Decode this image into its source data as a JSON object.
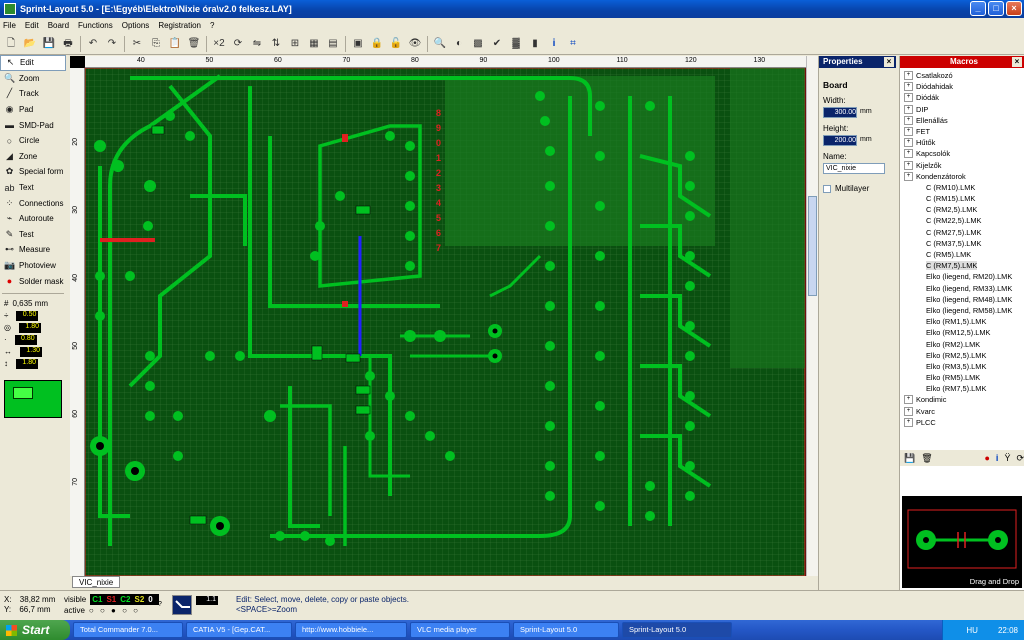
{
  "window": {
    "title": "Sprint-Layout 5.0 - [E:\\Egyéb\\Elektro\\Nixie óra\\v2.0 felkesz.LAY]"
  },
  "menu": [
    "File",
    "Edit",
    "Board",
    "Functions",
    "Options",
    "Registration",
    "?"
  ],
  "tools": [
    {
      "label": "Edit",
      "icon": "arrow-icon",
      "active": true
    },
    {
      "label": "Zoom",
      "icon": "magnifier-icon"
    },
    {
      "label": "Track",
      "icon": "track-icon"
    },
    {
      "label": "Pad",
      "icon": "pad-icon"
    },
    {
      "label": "SMD-Pad",
      "icon": "smd-pad-icon"
    },
    {
      "label": "Circle",
      "icon": "circle-icon"
    },
    {
      "label": "Zone",
      "icon": "zone-icon"
    },
    {
      "label": "Special form",
      "icon": "special-form-icon"
    },
    {
      "label": "Text",
      "icon": "text-icon"
    },
    {
      "label": "Connections",
      "icon": "connections-icon"
    },
    {
      "label": "Autoroute",
      "icon": "autoroute-icon"
    },
    {
      "label": "Test",
      "icon": "test-icon"
    },
    {
      "label": "Measure",
      "icon": "measure-icon"
    },
    {
      "label": "Photoview",
      "icon": "camera-icon"
    },
    {
      "label": "Solder mask",
      "icon": "solder-mask-icon"
    }
  ],
  "settings": {
    "grid": "0,635 mm",
    "track_width": "0.50",
    "pad_outer": "1.80",
    "pad_inner": "0.80",
    "smd_w": "1.30",
    "smd_h": "1.80"
  },
  "ruler": {
    "h": [
      "40",
      "50",
      "60",
      "70",
      "80",
      "90",
      "100",
      "110",
      "120",
      "130"
    ],
    "v": [
      "20",
      "30",
      "40",
      "50",
      "60",
      "70"
    ]
  },
  "canvas": {
    "board_tab": "VIC_nixie",
    "digits": [
      "8",
      "9",
      "0",
      "1",
      "2",
      "3",
      "4",
      "5",
      "6",
      "7"
    ]
  },
  "properties": {
    "title": "Properties",
    "section": "Board",
    "width_label": "Width:",
    "width_value": "300.00",
    "height_label": "Height:",
    "height_value": "200.00",
    "unit": "mm",
    "name_label": "Name:",
    "name_value": "VIC_nixie",
    "multilayer_label": "Multilayer"
  },
  "macros": {
    "title": "Macros",
    "items": [
      {
        "label": "Csatlakozó",
        "level": 0
      },
      {
        "label": "Diódahidak",
        "level": 0
      },
      {
        "label": "Diódák",
        "level": 0
      },
      {
        "label": "DIP",
        "level": 0
      },
      {
        "label": "Ellenállás",
        "level": 0
      },
      {
        "label": "FET",
        "level": 0
      },
      {
        "label": "Hűtők",
        "level": 0
      },
      {
        "label": "Kapcsolók",
        "level": 0
      },
      {
        "label": "Kijelzők",
        "level": 0
      },
      {
        "label": "Kondenzátorok",
        "level": 0
      },
      {
        "label": "C (RM10).LMK",
        "level": 1
      },
      {
        "label": "C (RM15).LMK",
        "level": 1
      },
      {
        "label": "C (RM2,5).LMK",
        "level": 1
      },
      {
        "label": "C (RM22,5).LMK",
        "level": 1
      },
      {
        "label": "C (RM27,5).LMK",
        "level": 1
      },
      {
        "label": "C (RM37,5).LMK",
        "level": 1
      },
      {
        "label": "C (RM5).LMK",
        "level": 1
      },
      {
        "label": "C (RM7,5).LMK",
        "level": 1,
        "selected": true
      },
      {
        "label": "Elko (liegend, RM20).LMK",
        "level": 1
      },
      {
        "label": "Elko (liegend, RM33).LMK",
        "level": 1
      },
      {
        "label": "Elko (liegend, RM48).LMK",
        "level": 1
      },
      {
        "label": "Elko (liegend, RM58).LMK",
        "level": 1
      },
      {
        "label": "Elko (RM1,5).LMK",
        "level": 1
      },
      {
        "label": "Elko (RM12,5).LMK",
        "level": 1
      },
      {
        "label": "Elko (RM2).LMK",
        "level": 1
      },
      {
        "label": "Elko (RM2,5).LMK",
        "level": 1
      },
      {
        "label": "Elko (RM3,5).LMK",
        "level": 1
      },
      {
        "label": "Elko (RM5).LMK",
        "level": 1
      },
      {
        "label": "Elko (RM7,5).LMK",
        "level": 1
      },
      {
        "label": "Kondimic",
        "level": 0
      },
      {
        "label": "Kvarc",
        "level": 0
      },
      {
        "label": "PLCC",
        "level": 0
      }
    ],
    "preview_label": "Drag and Drop"
  },
  "status": {
    "x_label": "X:",
    "x_value": "38,82 mm",
    "y_label": "Y:",
    "y_value": "66,7 mm",
    "visible_label": "visible",
    "active_label": "active",
    "layers": [
      "C1",
      "S1",
      "C2",
      "S2",
      "0"
    ],
    "help_button": "?",
    "track_value": "1.1",
    "hint_line1": "Edit: Select, move, delete, copy or paste objects.",
    "hint_line2": "<SPACE>=Zoom"
  },
  "taskbar": {
    "start": "Start",
    "items": [
      {
        "label": "Total Commander 7.0..."
      },
      {
        "label": "CATIA V5 - [Gep.CAT..."
      },
      {
        "label": "http://www.hobbiele..."
      },
      {
        "label": "VLC media player"
      },
      {
        "label": "Sprint-Layout 5.0"
      },
      {
        "label": "Sprint-Layout 5.0",
        "active": true
      }
    ],
    "lang": "HU",
    "clock": "22:08"
  },
  "colors": {
    "board_copper": "#00c020",
    "board_bg": "#0a5010",
    "ground_fill": "#116a18",
    "selection_red": "#e02020"
  }
}
